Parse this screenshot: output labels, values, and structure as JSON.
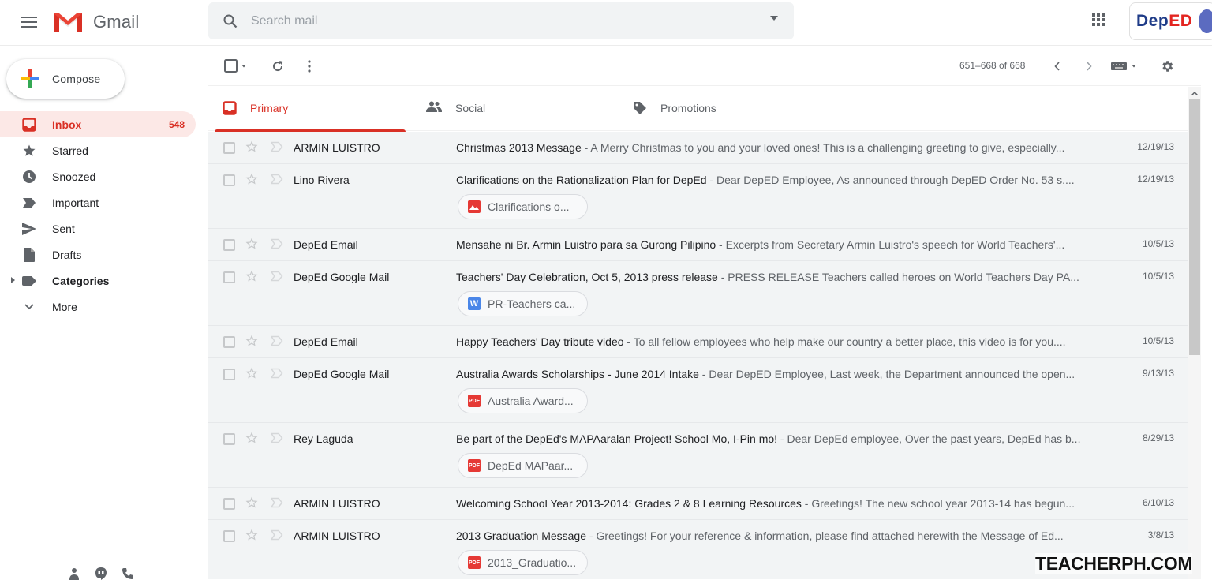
{
  "app": {
    "name": "Gmail"
  },
  "search": {
    "placeholder": "Search mail"
  },
  "account": {
    "logo_part1": "Dep",
    "logo_part2": "ED"
  },
  "compose": {
    "label": "Compose"
  },
  "sidebar": {
    "items": [
      {
        "label": "Inbox",
        "count": "548",
        "icon": "inbox-icon",
        "active": true
      },
      {
        "label": "Starred",
        "icon": "star-icon"
      },
      {
        "label": "Snoozed",
        "icon": "clock-icon"
      },
      {
        "label": "Important",
        "icon": "important-icon"
      },
      {
        "label": "Sent",
        "icon": "send-icon"
      },
      {
        "label": "Drafts",
        "icon": "draft-icon"
      },
      {
        "label": "Categories",
        "icon": "label-icon"
      },
      {
        "label": "More",
        "icon": "chevron-down-icon"
      }
    ]
  },
  "toolbar": {
    "pager": "651–668 of 668"
  },
  "tabs": [
    {
      "label": "Primary",
      "active": true
    },
    {
      "label": "Social"
    },
    {
      "label": "Promotions"
    }
  ],
  "emails": [
    {
      "sender": "ARMIN LUISTRO",
      "subject": "Christmas 2013 Message",
      "snippet": " - A Merry Christmas to you and your loved ones! This is a challenging greeting to give, especially...",
      "date": "12/19/13"
    },
    {
      "sender": "Lino Rivera",
      "subject": "Clarifications on the Rationalization Plan for DepEd",
      "snippet": " - Dear DepED Employee, As announced through DepED Order No. 53 s....",
      "date": "12/19/13",
      "attachment": {
        "name": "Clarifications o...",
        "type": "image"
      }
    },
    {
      "sender": "DepEd Email",
      "subject": "Mensahe ni Br. Armin Luistro para sa Gurong Pilipino",
      "snippet": " - Excerpts from Secretary Armin Luistro's speech for World Teachers'...",
      "date": "10/5/13"
    },
    {
      "sender": "DepEd Google Mail",
      "subject": "Teachers' Day Celebration, Oct 5, 2013 press release",
      "snippet": " - PRESS RELEASE Teachers called heroes on World Teachers Day PA...",
      "date": "10/5/13",
      "attachment": {
        "name": "PR-Teachers ca...",
        "type": "word"
      }
    },
    {
      "sender": "DepEd Email",
      "subject": "Happy Teachers' Day tribute video",
      "snippet": " - To all fellow employees who help make our country a better place, this video is for you....",
      "date": "10/5/13"
    },
    {
      "sender": "DepEd Google Mail",
      "subject": "Australia Awards Scholarships - June 2014 Intake",
      "snippet": " - Dear DepED Employee, Last week, the Department announced the open...",
      "date": "9/13/13",
      "attachment": {
        "name": "Australia Award...",
        "type": "pdf"
      }
    },
    {
      "sender": "Rey Laguda",
      "subject": "Be part of the DepEd's MAPAaralan Project! School Mo, I-Pin mo!",
      "snippet": " - Dear DepEd employee, Over the past years, DepEd has b...",
      "date": "8/29/13",
      "attachment": {
        "name": "DepEd MAPaar...",
        "type": "pdf"
      }
    },
    {
      "sender": "ARMIN LUISTRO",
      "subject": "Welcoming School Year 2013-2014: Grades 2 & 8 Learning Resources",
      "snippet": " - Greetings! The new school year 2013-14 has begun...",
      "date": "6/10/13"
    },
    {
      "sender": "ARMIN LUISTRO",
      "subject": "2013 Graduation Message",
      "snippet": " - Greetings! For your reference & information, please find attached herewith the Message of Ed...",
      "date": "3/8/13",
      "attachment": {
        "name": "2013_Graduatio...",
        "type": "pdf"
      }
    }
  ],
  "attachment_icons": {
    "pdf": "PDF",
    "word": "W"
  },
  "colors": {
    "accent": "#d93025",
    "inbox_bg": "#fce8e6",
    "word": "#4a86e8",
    "pdf": "#e53935"
  },
  "watermark": "TEACHERPH.COM"
}
